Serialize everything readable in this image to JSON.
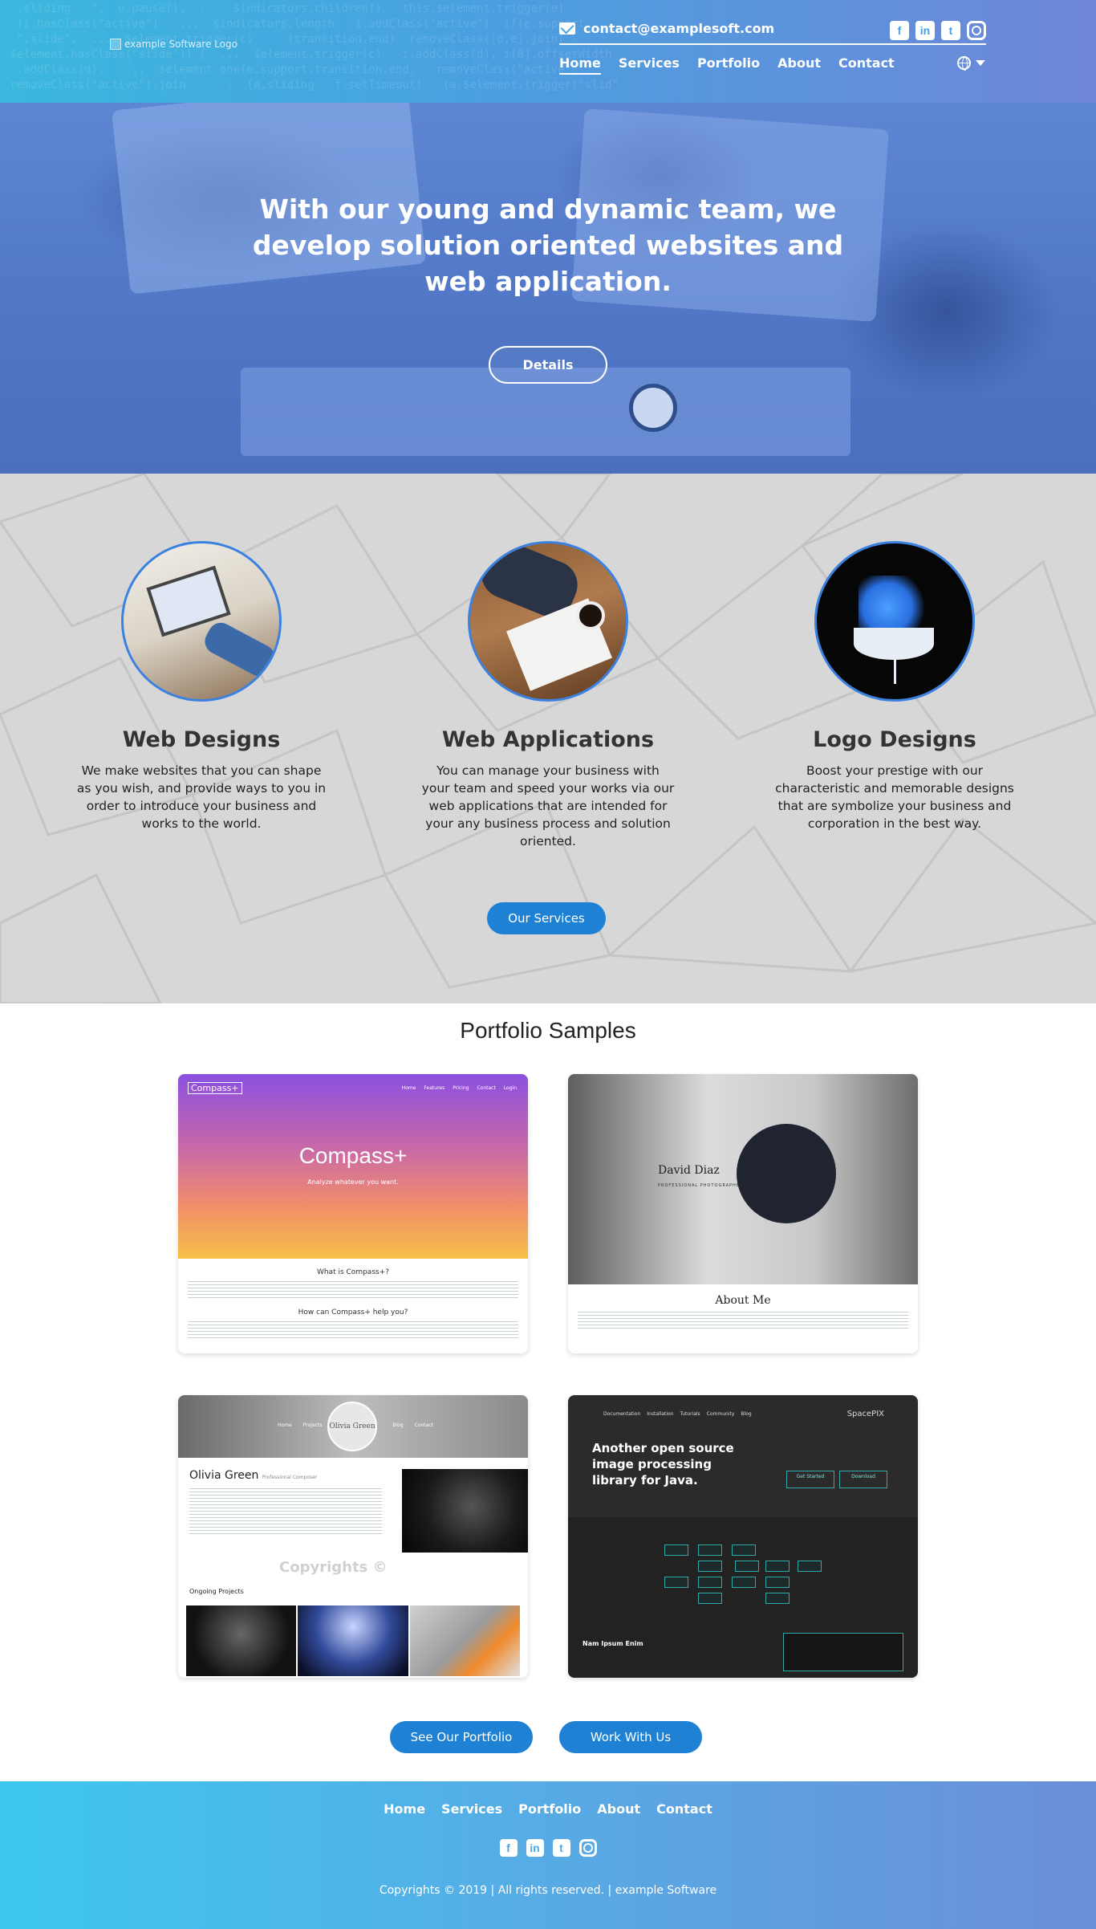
{
  "header": {
    "logo_alt": "example Software Logo",
    "email": "contact@examplesoft.com",
    "nav": [
      "Home",
      "Services",
      "Portfolio",
      "About",
      "Contact"
    ],
    "social_icons": [
      "facebook-icon",
      "linkedin-icon",
      "twitter-icon",
      "instagram-icon"
    ],
    "language_icon": "globe-icon"
  },
  "hero": {
    "headline": "With our young and dynamic team, we develop solution oriented websites and web application.",
    "button": "Details"
  },
  "services": {
    "items": [
      {
        "title": "Web Designs",
        "text": "We make websites that you can shape as you wish, and provide ways to you in order to introduce your business and works to the world."
      },
      {
        "title": "Web Applications",
        "text": "You can manage your business with your team and speed your works via our web applications that are intended for your any business process and solution oriented."
      },
      {
        "title": "Logo Designs",
        "text": "Boost your prestige with our characteristic and memorable designs that are symbolize your business and corporation in the best way."
      }
    ],
    "button": "Our Services"
  },
  "portfolio": {
    "title": "Portfolio Samples",
    "card1": {
      "brand": "Compass+",
      "nav": [
        "Home",
        "Features",
        "Pricing",
        "Contact",
        "Login"
      ],
      "headline": "Compass+",
      "sub": "Analyze whatever you want.",
      "q1": "What is Compass+?",
      "q2": "How can Compass+ help you?"
    },
    "card2": {
      "name": "David Diaz",
      "role": "PROFESSIONAL PHOTOGRAPHER",
      "about": "About Me"
    },
    "card3": {
      "nav": [
        "Home",
        "Projects",
        "Blog",
        "Contact"
      ],
      "logo": "Olivia Green",
      "name": "Olivia Green",
      "role": "Professional Composer",
      "watermark": "Copyrights ©",
      "ongoing": "Ongoing Projects"
    },
    "card4": {
      "nav": [
        "Documentation",
        "Installation",
        "Tutorials",
        "Community",
        "Blog"
      ],
      "brand": "SpacePIX",
      "headline": "Another open source image processing library for Java.",
      "btn1": "Get Started",
      "btn2": "Download",
      "section": "Nam Ipsum Enim"
    },
    "buttons": [
      "See Our Portfolio",
      "Work With Us"
    ]
  },
  "footer": {
    "nav": [
      "Home",
      "Services",
      "Portfolio",
      "About",
      "Contact"
    ],
    "social_icons": [
      "facebook-icon",
      "linkedin-icon",
      "twitter-icon",
      "instagram-icon"
    ],
    "copyright": "Copyrights © 2019 | All rights reserved. | example Software"
  },
  "colors": {
    "accent": "#1e81d3",
    "header_start": "#3bb8de",
    "header_end": "#6f86d8",
    "hero_overlay": "#5b83cf"
  }
}
